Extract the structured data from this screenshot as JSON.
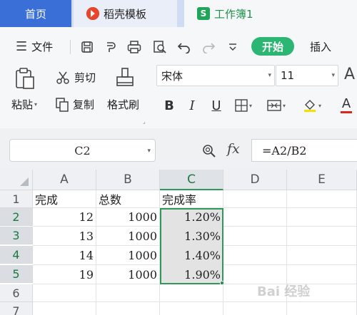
{
  "tabs": [
    {
      "label": "首页",
      "icon": "home"
    },
    {
      "label": "稻壳模板",
      "icon": "docer-icon"
    },
    {
      "label": "工作簿1",
      "icon": "spreadsheet-icon",
      "icon_letter": "S"
    }
  ],
  "menu": {
    "file_label": "文件",
    "start_label": "开始",
    "insert_label": "插入"
  },
  "ribbon": {
    "paste_label": "粘贴",
    "cut_label": "剪切",
    "copy_label": "复制",
    "format_painter_label": "格式刷",
    "font_name": "宋体",
    "font_size": "11",
    "bold": "B",
    "italic": "I",
    "underline": "U",
    "font_color_letter": "A"
  },
  "formula_bar": {
    "name_box": "C2",
    "fx_label": "fx",
    "formula": "=A2/B2"
  },
  "sheet": {
    "columns": [
      "A",
      "B",
      "C",
      "D",
      "E"
    ],
    "rows": [
      "1",
      "2",
      "3",
      "4",
      "5",
      "6",
      "7"
    ],
    "cells": [
      [
        "完成",
        "总数",
        "完成率"
      ],
      [
        "12",
        "1000",
        "1.20%"
      ],
      [
        "13",
        "1000",
        "1.30%"
      ],
      [
        "14",
        "1000",
        "1.40%"
      ],
      [
        "19",
        "1000",
        "1.90%"
      ]
    ],
    "selected_range": "C2:C5"
  },
  "watermark": "Bai 经验",
  "colors": {
    "accent_blue": "#3a6fd8",
    "start_green": "#2bb673",
    "selection_green": "#2f9a57",
    "docer_red": "#e8452c"
  }
}
